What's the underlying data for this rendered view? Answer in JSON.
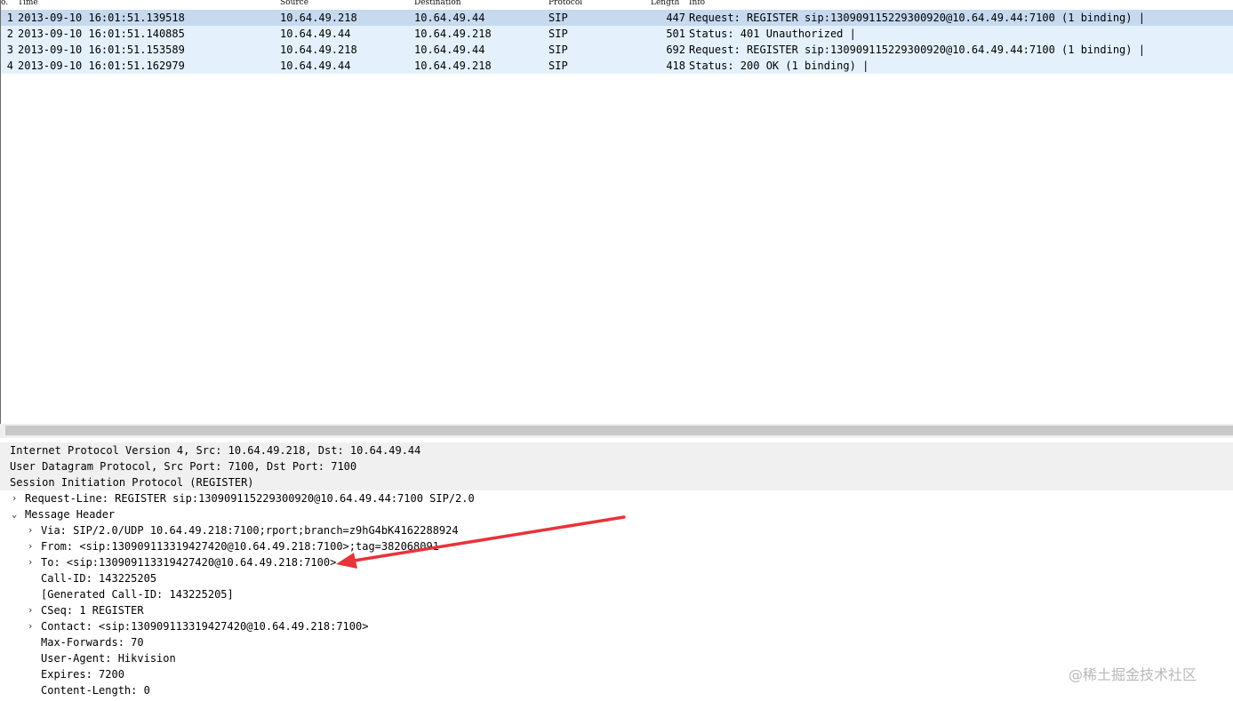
{
  "packet_list": {
    "columns": [
      {
        "key": "no",
        "label": "o."
      },
      {
        "key": "time",
        "label": "Time"
      },
      {
        "key": "source",
        "label": "Source"
      },
      {
        "key": "destination",
        "label": "Destination"
      },
      {
        "key": "protocol",
        "label": "Protocol"
      },
      {
        "key": "length",
        "label": "Length"
      },
      {
        "key": "info",
        "label": "Info"
      }
    ],
    "rows": [
      {
        "no": "1",
        "time": "2013-09-10 16:01:51.139518",
        "source": "10.64.49.218",
        "destination": "10.64.49.44",
        "protocol": "SIP",
        "length": "447",
        "info": "Request: REGISTER sip:130909115229300920@10.64.49.44:7100  (1 binding) |",
        "selected": true
      },
      {
        "no": "2",
        "time": "2013-09-10 16:01:51.140885",
        "source": "10.64.49.44",
        "destination": "10.64.49.218",
        "protocol": "SIP",
        "length": "501",
        "info": "Status: 401 Unauthorized |",
        "selected": false
      },
      {
        "no": "3",
        "time": "2013-09-10 16:01:51.153589",
        "source": "10.64.49.218",
        "destination": "10.64.49.44",
        "protocol": "SIP",
        "length": "692",
        "info": "Request: REGISTER sip:130909115229300920@10.64.49.44:7100  (1 binding) |",
        "selected": false
      },
      {
        "no": "4",
        "time": "2013-09-10 16:01:51.162979",
        "source": "10.64.49.44",
        "destination": "10.64.49.218",
        "protocol": "SIP",
        "length": "418",
        "info": "Status: 200 OK  (1 binding) |",
        "selected": false
      }
    ]
  },
  "details": {
    "lines": [
      {
        "text": "Internet Protocol Version 4, Src: 10.64.49.218, Dst: 10.64.49.44",
        "expander": "",
        "shaded": true,
        "name": "ip-layer"
      },
      {
        "text": "User Datagram Protocol, Src Port: 7100, Dst Port: 7100",
        "expander": "",
        "shaded": true,
        "name": "udp-layer"
      },
      {
        "text": "Session Initiation Protocol (REGISTER)",
        "expander": "",
        "shaded": true,
        "name": "sip-layer"
      },
      {
        "text": "Request-Line: REGISTER sip:130909115229300920@10.64.49.44:7100 SIP/2.0",
        "expander": "›",
        "shaded": false,
        "name": "sip-request-line"
      },
      {
        "text": "Message Header",
        "expander": "⌄",
        "shaded": false,
        "name": "sip-message-header"
      },
      {
        "text": "Via: SIP/2.0/UDP 10.64.49.218:7100;rport;branch=z9hG4bK4162288924",
        "expander": "›",
        "shaded": false,
        "name": "sip-via"
      },
      {
        "text": "From: <sip:130909113319427420@10.64.49.218:7100>;tag=382068091",
        "expander": "›",
        "shaded": false,
        "name": "sip-from"
      },
      {
        "text": "To: <sip:130909113319427420@10.64.49.218:7100>",
        "expander": "›",
        "shaded": false,
        "name": "sip-to"
      },
      {
        "text": "Call-ID: 143225205",
        "expander": "",
        "shaded": false,
        "name": "sip-call-id"
      },
      {
        "text": "[Generated Call-ID: 143225205]",
        "expander": "",
        "shaded": false,
        "name": "sip-generated-call-id"
      },
      {
        "text": "CSeq: 1 REGISTER",
        "expander": "›",
        "shaded": false,
        "name": "sip-cseq"
      },
      {
        "text": "Contact: <sip:130909113319427420@10.64.49.218:7100>",
        "expander": "›",
        "shaded": false,
        "name": "sip-contact"
      },
      {
        "text": "Max-Forwards: 70",
        "expander": "",
        "shaded": false,
        "name": "sip-max-forwards"
      },
      {
        "text": "User-Agent: Hikvision",
        "expander": "",
        "shaded": false,
        "name": "sip-user-agent"
      },
      {
        "text": "Expires: 7200",
        "expander": "",
        "shaded": false,
        "name": "sip-expires"
      },
      {
        "text": "Content-Length: 0",
        "expander": "",
        "shaded": false,
        "name": "sip-content-length"
      }
    ]
  },
  "watermark": "@稀土掘金技术社区",
  "colors": {
    "selected_row": "#c6d9ef",
    "normal_row": "#e4f1fc",
    "annotation_arrow": "#e8333a"
  }
}
